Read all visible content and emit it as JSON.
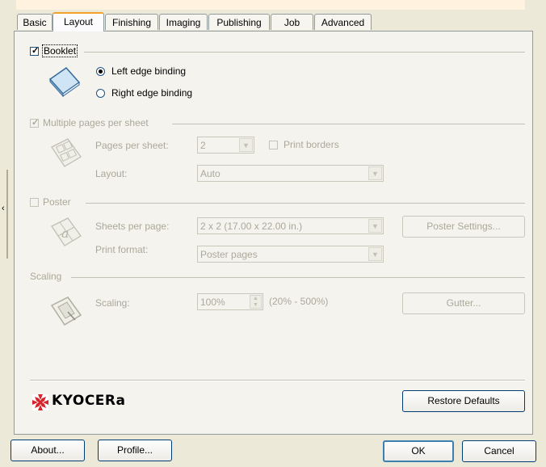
{
  "tabs": [
    {
      "label": "Basic"
    },
    {
      "label": "Layout",
      "active": true
    },
    {
      "label": "Finishing"
    },
    {
      "label": "Imaging"
    },
    {
      "label": "Publishing"
    },
    {
      "label": "Job"
    },
    {
      "label": "Advanced"
    }
  ],
  "booklet": {
    "label": "Booklet",
    "checked": true,
    "options": [
      {
        "label": "Left edge binding",
        "selected": true
      },
      {
        "label": "Right edge binding",
        "selected": false
      }
    ]
  },
  "multiple_pages": {
    "label": "Multiple pages per sheet",
    "checked": true,
    "pages_per_sheet_label": "Pages per sheet:",
    "pages_per_sheet_value": "2",
    "print_borders_label": "Print borders",
    "layout_label": "Layout:",
    "layout_value": "Auto"
  },
  "poster": {
    "label": "Poster",
    "sheets_per_page_label": "Sheets per page:",
    "sheets_per_page_value": "2 x 2 (17.00 x 22.00 in.)",
    "print_format_label": "Print format:",
    "print_format_value": "Poster pages",
    "settings_button": "Poster Settings..."
  },
  "scaling": {
    "label": "Scaling",
    "scaling_label": "Scaling:",
    "scaling_value": "100%",
    "range_text": "(20% - 500%)",
    "gutter_button": "Gutter..."
  },
  "brand": {
    "name": "KYOCERa",
    "color": "#d7232b"
  },
  "restore_defaults": "Restore Defaults",
  "bottom": {
    "about": "About...",
    "profile": "Profile...",
    "ok": "OK",
    "cancel": "Cancel"
  },
  "colors": {
    "dialog_bg": "#ece9d8",
    "panel_bg": "#f4f3ee",
    "active_tab_accent": "#f2a12b",
    "disabled_text": "#aca899"
  }
}
